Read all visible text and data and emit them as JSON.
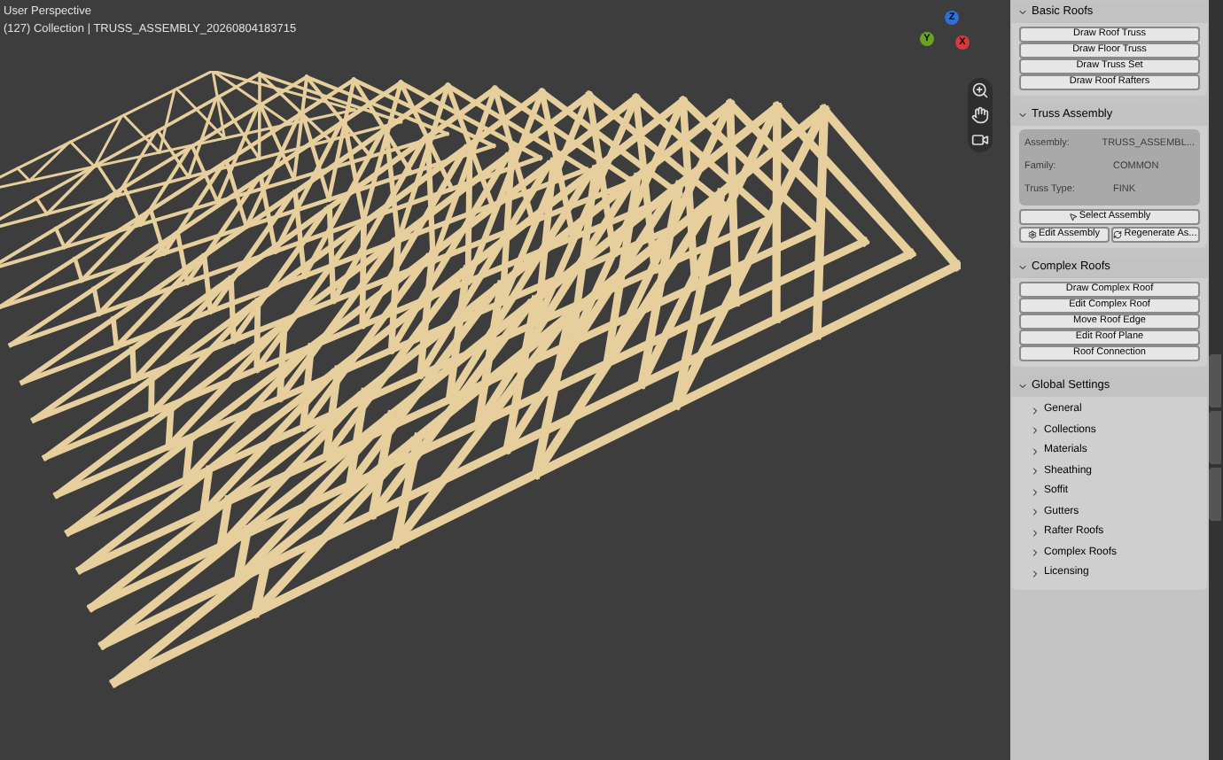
{
  "viewport": {
    "view_name": "User Perspective",
    "collection_info": "(127) Collection | TRUSS_ASSEMBLY_20260804183715"
  },
  "gizmo": {
    "axes": [
      {
        "label": "Z",
        "color": "#2f6fd6"
      },
      {
        "label": "Y",
        "color": "#6aa322"
      },
      {
        "label": "X",
        "color": "#d63a3a"
      }
    ]
  },
  "panels": [
    {
      "title": "Basic Roofs",
      "expanded": true,
      "kind": "buttons",
      "buttons": [
        "Draw Roof Truss",
        "Draw Floor Truss",
        "Draw Truss Set",
        "Draw Roof Rafters"
      ]
    },
    {
      "title": "Truss Assembly",
      "expanded": true,
      "kind": "assembly",
      "fields": [
        {
          "label": "Assembly:",
          "value": "TRUSS_ASSEMBL..."
        },
        {
          "label": "Family:",
          "value": "COMMON"
        },
        {
          "label": "Truss Type:",
          "value": "FINK"
        }
      ],
      "actions": [
        {
          "label": "Select Assembly"
        },
        {
          "label": "Edit Assembly"
        },
        {
          "label": "Regenerate As..."
        }
      ]
    },
    {
      "title": "Complex Roofs",
      "expanded": true,
      "kind": "buttons",
      "buttons": [
        "Draw Complex Roof",
        "Edit Complex Roof",
        "Move Roof Edge",
        "Edit Roof Plane",
        "Roof Connection"
      ]
    },
    {
      "title": "Global Settings",
      "expanded": true,
      "kind": "subpanels",
      "items": [
        {
          "label": "General",
          "expanded": false
        },
        {
          "label": "Collections",
          "expanded": false
        },
        {
          "label": "Materials",
          "expanded": false
        },
        {
          "label": "Sheathing",
          "expanded": false
        },
        {
          "label": "Soffit",
          "expanded": false
        },
        {
          "label": "Gutters",
          "expanded": false
        },
        {
          "label": "Rafter Roofs",
          "expanded": false
        },
        {
          "label": "Complex Roofs",
          "expanded": false
        },
        {
          "label": "Licensing",
          "expanded": false
        }
      ]
    }
  ]
}
